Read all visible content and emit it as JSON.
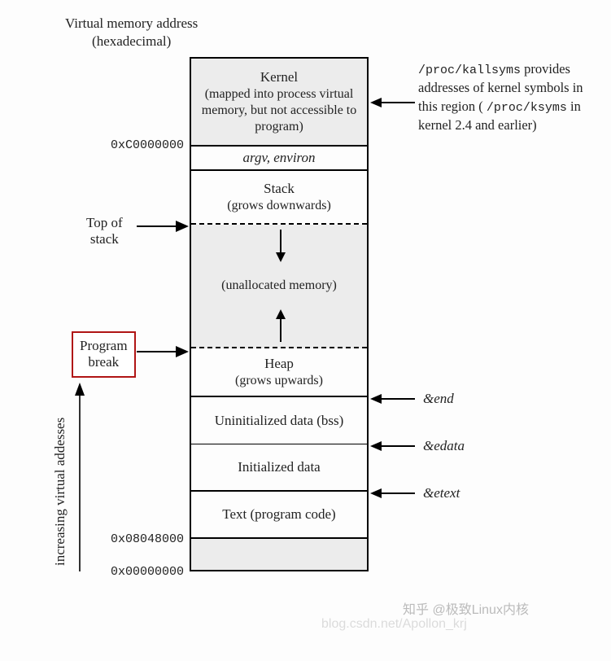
{
  "title": {
    "line1": "Virtual memory address",
    "line2": "(hexadecimal)"
  },
  "segments": {
    "kernel": {
      "title": "Kernel",
      "sub": "(mapped into process virtual memory, but not accessible to program)"
    },
    "argv": "argv, environ",
    "stack": {
      "title": "Stack",
      "sub": "(grows downwards)"
    },
    "unalloc": "(unallocated memory)",
    "heap": {
      "title": "Heap",
      "sub": "(grows upwards)"
    },
    "bss": "Uninitialized data (bss)",
    "data": "Initialized data",
    "text": "Text (program code)"
  },
  "addresses": {
    "kernel_base": "0xC0000000",
    "text_base": "0x08048000",
    "zero": "0x00000000"
  },
  "labels": {
    "top_of_stack": {
      "l1": "Top of",
      "l2": "stack"
    },
    "program_break": {
      "l1": "Program",
      "l2": "break"
    },
    "increasing": "increasing virtual addesses"
  },
  "kallsyms_note": {
    "part1": "provides addresses of kernel symbols in this region (",
    "part2": " in kernel 2.4 and earlier)",
    "sym1": "/proc/kallsyms",
    "sym2": "/proc/ksyms"
  },
  "symbols": {
    "end": "&end",
    "edata": "&edata",
    "etext": "&etext"
  },
  "watermark": {
    "zhihu": "知乎 @极致Linux内核",
    "csdn": "blog.csdn.net/Apollon_krj"
  }
}
